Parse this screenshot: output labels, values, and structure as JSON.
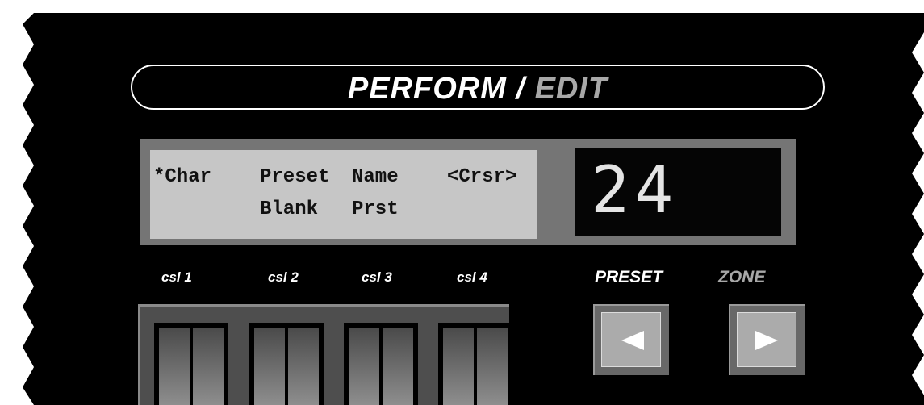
{
  "title": {
    "main": "PERFORM /",
    "accent": "EDIT"
  },
  "lcd": {
    "line1": {
      "col1": "*Char",
      "col2": "Preset",
      "col3": "Name",
      "col4": "<Crsr>"
    },
    "line2": {
      "col2": "Blank",
      "col3": "Prst"
    }
  },
  "led": {
    "value": "24"
  },
  "sliders": {
    "labels": [
      "csl 1",
      "csl 2",
      "csl 3",
      "csl 4"
    ]
  },
  "buttons": {
    "preset_label": "PRESET",
    "zone_label": "ZONE"
  },
  "colors": {
    "panel": "#000000",
    "lcd_bg": "#c6c6c6",
    "lcd_frame": "#757575",
    "button_face": "#ababab"
  },
  "icons": {
    "left_button": "triangle-left-icon",
    "right_button": "triangle-right-icon"
  }
}
